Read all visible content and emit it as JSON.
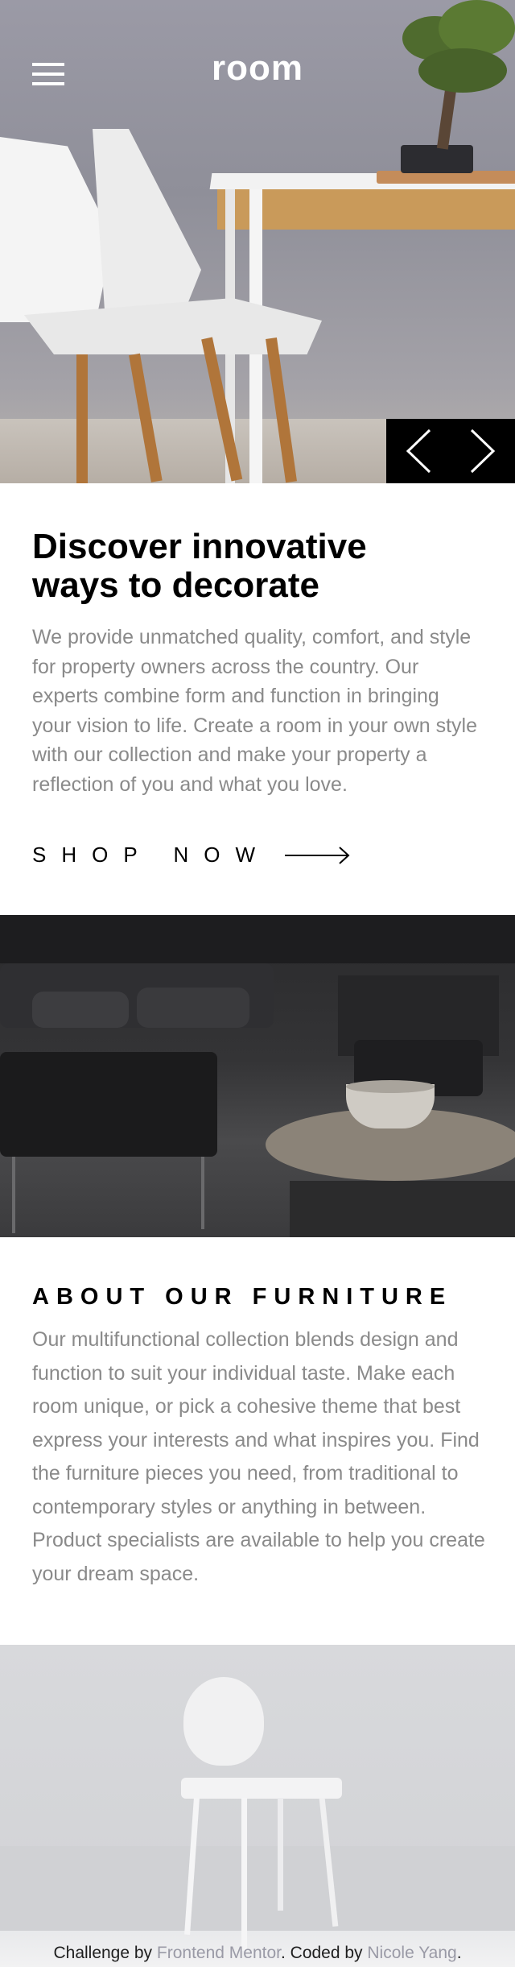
{
  "header": {
    "logo": "room",
    "menu_icon": "hamburger-menu-icon"
  },
  "slider": {
    "prev_icon": "chevron-left-icon",
    "next_icon": "chevron-right-icon"
  },
  "hero": {
    "headline_line1": "Discover innovative",
    "headline_line2": "ways to decorate",
    "body": "We provide unmatched quality, comfort, and style for property owners across the country. Our experts combine form and function in bringing your vision to life. Create a room in your own style with our collection and make your property a reflection of you and what you love.",
    "cta_label": "SHOP NOW",
    "cta_icon": "arrow-right-icon"
  },
  "about": {
    "title": "ABOUT OUR FURNITURE",
    "body": "Our multifunctional collection blends design and function to suit your individual taste. Make each room unique, or pick a cohesive theme that best express your interests and what inspires you. Find the furniture pieces you need, from traditional to contemporary styles or anything in between. Product specialists are available to help you create your dream space."
  },
  "footer": {
    "prefix": "Challenge by ",
    "challenge_link": "Frontend Mentor",
    "middle": ". Coded by ",
    "author_link": "Nicole Yang",
    "suffix": "."
  },
  "colors": {
    "text_primary": "#000000",
    "text_body": "#8a8a8a",
    "slider_bg": "#000000",
    "link_muted": "#9a9aa6"
  }
}
